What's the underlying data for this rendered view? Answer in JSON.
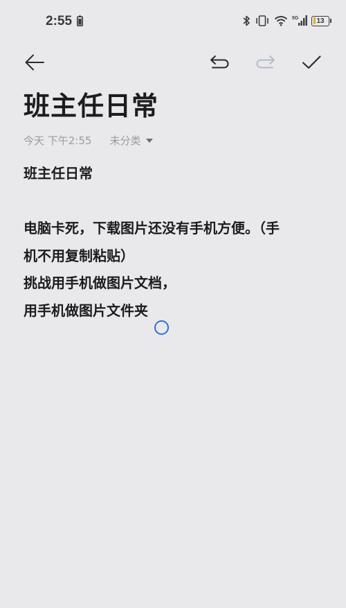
{
  "status_bar": {
    "time": "2:55",
    "battery_level": "13",
    "network": "5G"
  },
  "toolbar": {
    "back_icon": "arrow-left-icon",
    "undo_icon": "undo-icon",
    "redo_icon": "redo-icon",
    "done_icon": "check-icon"
  },
  "note": {
    "title": "班主任日常",
    "date": "今天 下午2:55",
    "category": "未分类",
    "lines": [
      "班主任日常",
      "",
      "电脑卡死，下载图片还没有手机方便。（手",
      "机不用复制粘贴）",
      "挑战用手机做图片文档，",
      "用手机做图片文件夹"
    ]
  },
  "colors": {
    "background": "#e9e9eb",
    "text": "#1c1c1e",
    "meta_text": "#9a9aa2",
    "cursor": "#2f6fd6",
    "redo_disabled": "#b4b9cc"
  }
}
